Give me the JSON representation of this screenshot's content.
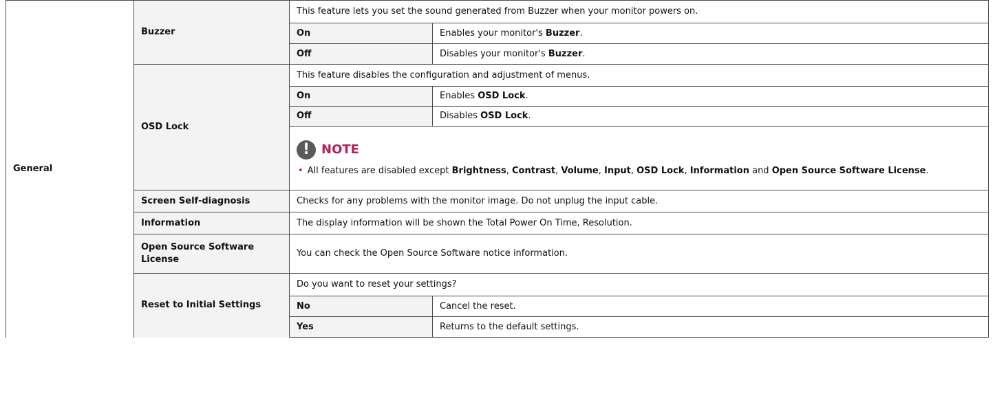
{
  "category": "General",
  "buzzer": {
    "label": "Buzzer",
    "description": "This feature lets you set the sound generated from Buzzer when your monitor powers on.",
    "on_label": "On",
    "on_prefix": "Enables your monitor's ",
    "on_bold": "Buzzer",
    "on_suffix": ".",
    "off_label": "Off",
    "off_prefix": "Disables your monitor's ",
    "off_bold": "Buzzer",
    "off_suffix": "."
  },
  "osd_lock": {
    "label": "OSD Lock",
    "description": "This feature disables the configuration and adjustment of menus.",
    "on_label": "On",
    "on_prefix": "Enables ",
    "on_bold": "OSD Lock",
    "on_suffix": ".",
    "off_label": "Off",
    "off_prefix": "Disables ",
    "off_bold": "OSD Lock",
    "off_suffix": ".",
    "note": {
      "icon_glyph": "!",
      "title": "NOTE",
      "bullet": "•",
      "t1": "All features are disabled except ",
      "b1": "Brightness",
      "s1": ", ",
      "b2": "Contrast",
      "s2": ", ",
      "b3": "Volume",
      "s3": ", ",
      "b4": "Input",
      "s4": ", ",
      "b5": "OSD Lock",
      "s5": ", ",
      "b6": "Information",
      "s6": " and ",
      "b7": "Open Source Software License",
      "s7": "."
    }
  },
  "self_diagnosis": {
    "label": "Screen Self-diagnosis",
    "description": "Checks for any problems with the monitor image. Do not unplug the input cable."
  },
  "information": {
    "label": "Information",
    "description": "The display information will be shown the Total Power On Time, Resolution."
  },
  "open_source": {
    "label": "Open Source Software License",
    "description": "You can check the Open Source Software notice information."
  },
  "reset": {
    "label": "Reset to Initial Settings",
    "description": "Do you want to reset your settings?",
    "no_label": "No",
    "no_desc": "Cancel the reset.",
    "yes_label": "Yes",
    "yes_desc": "Returns to the default settings."
  },
  "colors": {
    "accent": "#b4215a",
    "label_bg": "#f3f3f3",
    "border": "#4a4a4a",
    "icon_bg": "#5a5a5a"
  }
}
